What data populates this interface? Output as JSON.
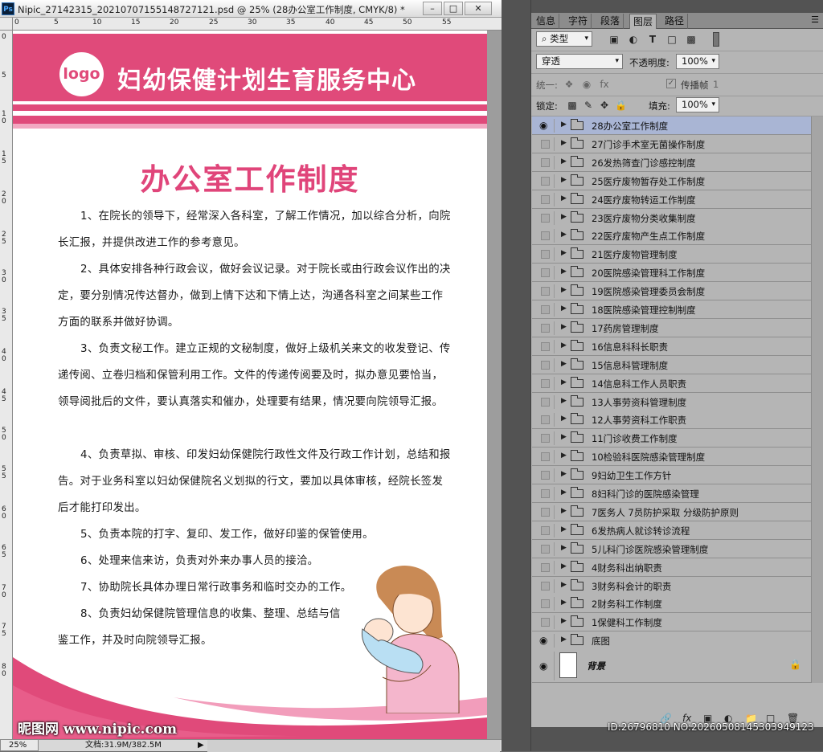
{
  "window": {
    "app_icon": "Ps",
    "title": "Nipic_27142315_20210707155148727121.psd @ 25% (28办公室工作制度, CMYK/8) *",
    "buttons": [
      "–",
      "□",
      "✕"
    ]
  },
  "rulers": {
    "top": [
      "0",
      "5",
      "10",
      "15",
      "20",
      "25",
      "30",
      "35",
      "40",
      "45",
      "50",
      "55"
    ],
    "left": [
      "0",
      "5",
      "10",
      "15",
      "20",
      "25",
      "30",
      "35",
      "40",
      "45",
      "50",
      "55",
      "60",
      "65",
      "70",
      "75",
      "80"
    ]
  },
  "poster": {
    "logo": "logo",
    "org_name": "妇幼保健计划生育服务中心",
    "title": "办公室工作制度",
    "paragraphs": [
      "1、在院长的领导下，经常深入各科室，了解工作情况，加以综合分析，向院长汇报，并提供改进工作的参考意见。",
      "2、具体安排各种行政会议，做好会议记录。对于院长或由行政会议作出的决定，要分别情况传达督办，做到上情下达和下情上达，沟通各科室之间某些工作方面的联系并做好协调。",
      "3、负责文秘工作。建立正规的文秘制度，做好上级机关来文的收发登记、传递传阅、立卷归档和保管利用工作。文件的传递传阅要及时，拟办意见要恰当，领导阅批后的文件，要认真落实和催办，处理要有结果，情况要向院领导汇报。",
      "4、负责草拟、审核、印发妇幼保健院行政性文件及行政工作计划，总结和报告。对于业务科室以妇幼保健院名义划拟的行文，要加以具体审核，经院长签发后才能打印发出。",
      "5、负责本院的打字、复印、发工作，做好印鉴的保管使用。",
      "6、处理来信来访，负责对外来办事人员的接洽。",
      "7、协助院长具体办理日常行政事务和临时交办的工作。",
      "8、负责妇幼保健院管理信息的收集、整理、总结与信鉴工作，并及时向院领导汇报。"
    ]
  },
  "watermark_left": "昵图网 www.nipic.com",
  "status": {
    "zoom": "25%",
    "doc_info": "文档:31.9M/382.5M"
  },
  "panel": {
    "tabs": [
      "信息",
      "字符",
      "段落",
      "图层",
      "路径"
    ],
    "active_tab": "图层",
    "filter_kind": "类型",
    "blend_mode": "穿透",
    "opacity_label": "不透明度:",
    "opacity": "100%",
    "unify_label": "统一:",
    "propagate_label": "传播帧",
    "propagate_value": "1",
    "lock_label": "锁定:",
    "fill_label": "填充:",
    "fill": "100%",
    "layers": [
      "28办公室工作制度",
      "27门诊手术室无菌操作制度",
      "26发热筛查门诊感控制度",
      "25医疗废物暂存处工作制度",
      "24医疗废物转运工作制度",
      "23医疗废物分类收集制度",
      "22医疗废物产生点工作制度",
      "21医疗废物管理制度",
      "20医院感染管理科工作制度",
      "19医院感染管理委员会制度",
      "18医院感染管理控制制度",
      "17药房管理制度",
      "16信息科科长职责",
      "15信息科管理制度",
      "14信息科工作人员职责",
      "13人事劳资科管理制度",
      "12人事劳资科工作职责",
      "11门诊收费工作制度",
      "10检验科医院感染管理制度",
      "9妇幼卫生工作方针",
      "8妇科门诊的医院感染管理",
      "7医务人 7员防护采取  分级防护原则",
      "6发热病人就诊转诊流程",
      "5儿科门诊医院感染管理制度",
      "4财务科出纳职责",
      "3财务科会计的职责",
      "2财务科工作制度",
      "1保健科工作制度",
      "底图"
    ],
    "background_layer": "背景",
    "id_watermark": "ID:26796810 NO:20260508145303949123"
  }
}
